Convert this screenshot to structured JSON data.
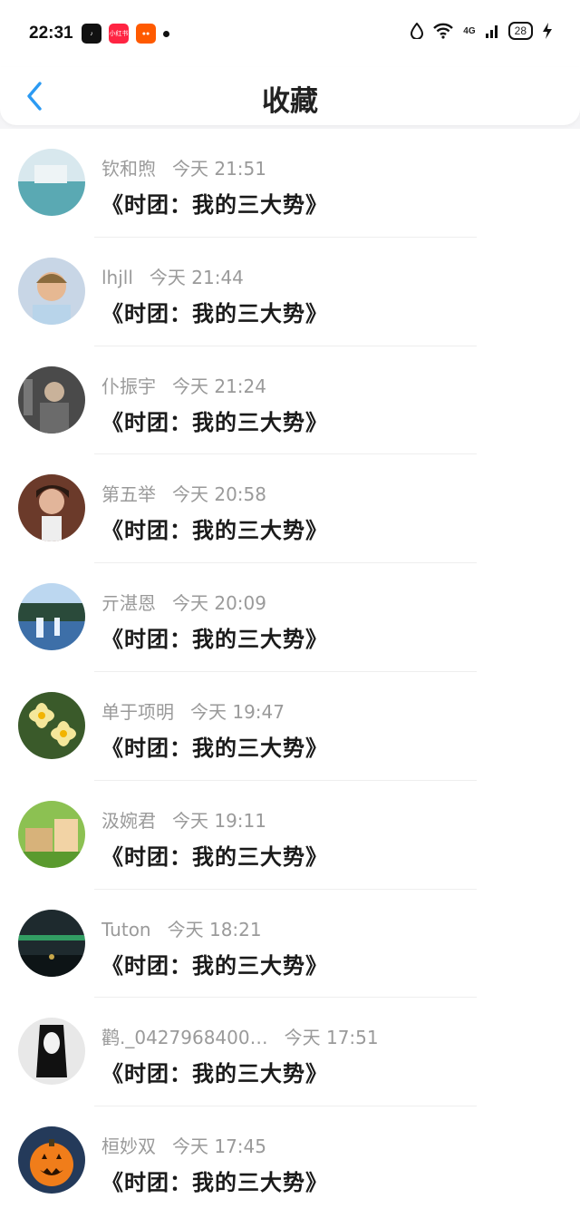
{
  "status_bar": {
    "time": "22:31",
    "app_icons": [
      "tiktok-icon",
      "xiaohongshu-icon",
      "kuaishou-icon"
    ],
    "network": "4G",
    "battery": "28"
  },
  "header": {
    "title": "收藏",
    "back_icon": "chevron-left-icon",
    "accent": "#2b9af3"
  },
  "favorites": [
    {
      "name": "钦和煦",
      "time": "今天 21:51",
      "message": "《时团：我的三大势》",
      "avatar_color": "#5aa9b3"
    },
    {
      "name": "lhjll",
      "time": "今天 21:44",
      "message": "《时团：我的三大势》",
      "avatar_color": "#c8d6e6"
    },
    {
      "name": "仆振宇",
      "time": "今天 21:24",
      "message": "《时团：我的三大势》",
      "avatar_color": "#4a4a4a"
    },
    {
      "name": "第五举",
      "time": "今天 20:58",
      "message": "《时团：我的三大势》",
      "avatar_color": "#6b3a2a"
    },
    {
      "name": "亓湛恩",
      "time": "今天 20:09",
      "message": "《时团：我的三大势》",
      "avatar_color": "#3d6fa8"
    },
    {
      "name": "单于项明",
      "time": "今天 19:47",
      "message": "《时团：我的三大势》",
      "avatar_color": "#f4e79a"
    },
    {
      "name": "汲婉君",
      "time": "今天 19:11",
      "message": "《时团：我的三大势》",
      "avatar_color": "#8cc152"
    },
    {
      "name": "Tuton",
      "time": "今天 18:21",
      "message": "《时团：我的三大势》",
      "avatar_color": "#1e2a2e"
    },
    {
      "name": "鹳._0427968400…",
      "time": "今天 17:51",
      "message": "《时团：我的三大势》",
      "avatar_color": "#e8e8e8"
    },
    {
      "name": "桓妙双",
      "time": "今天 17:45",
      "message": "《时团：我的三大势》",
      "avatar_color": "#f07d1a"
    }
  ]
}
